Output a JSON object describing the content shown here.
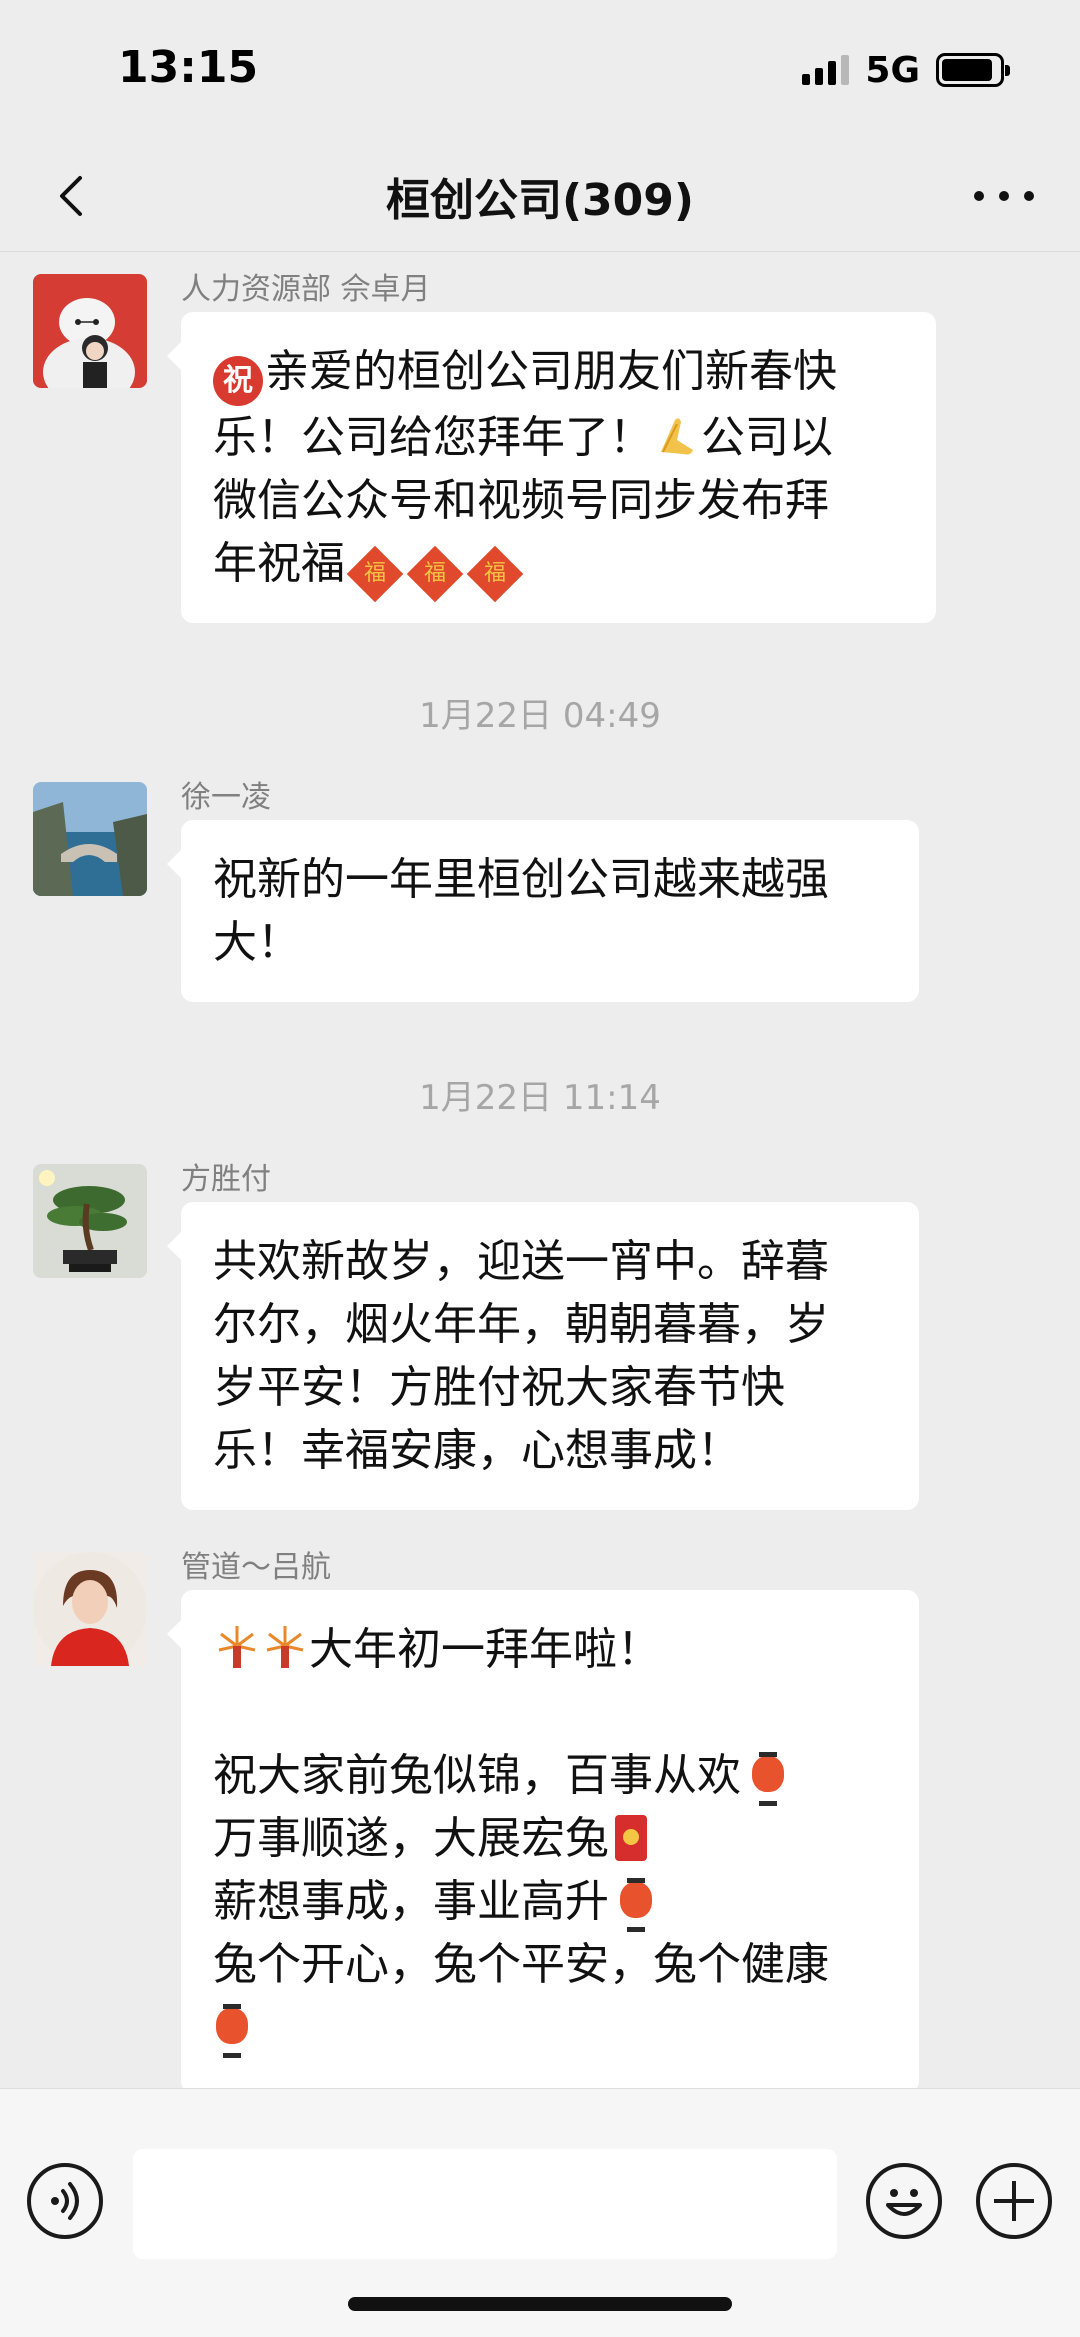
{
  "status_bar": {
    "time": "13:15",
    "network": "5G",
    "battery_level": 0.9
  },
  "header": {
    "back_icon": "chevron-left-icon",
    "title": "桓创公司(309)",
    "more_icon": "more-dots-icon"
  },
  "messages": [
    {
      "sender": "人力资源部 佘卓月",
      "avatar": "white robot holding child",
      "lines": [
        "亲爱的桓创公司朋友们新春快",
        "乐！公司给您拜年了！",
        "公司以",
        "微信公众号和视频号同步发布拜",
        "年祝福"
      ],
      "emoji": {
        "zhu": "祝",
        "fu": "福"
      }
    },
    {
      "timestamp": "1月22日 04:49"
    },
    {
      "sender": "徐一凌",
      "avatar": "coastal bridge landscape",
      "lines": [
        "祝新的一年里桓创公司越来越强",
        "大！"
      ]
    },
    {
      "timestamp": "1月22日 11:14"
    },
    {
      "sender": "方胜付",
      "avatar": "bonsai tree",
      "lines": [
        "共欢新故岁，迎送一宵中。辞暮",
        "尔尔，烟火年年，朝朝暮暮，岁",
        "岁平安！方胜付祝大家春节快",
        "乐！幸福安康，心想事成！"
      ]
    },
    {
      "sender": "管道～吕航",
      "avatar": "woman in red sweater",
      "lines": [
        "大年初一拜年啦！",
        "",
        "祝大家前兔似锦，百事从欢",
        "万事顺遂，大展宏兔",
        "薪想事成，事业高升",
        "兔个开心，兔个平安，兔个健康"
      ]
    }
  ],
  "input_bar": {
    "voice_icon": "voice-icon",
    "emoji_icon": "smiley-icon",
    "plus_icon": "plus-icon",
    "text": ""
  },
  "colors": {
    "background": "#ededed",
    "bubble": "#ffffff",
    "sender_text": "#808080",
    "timestamp_text": "#a6a6a6"
  }
}
